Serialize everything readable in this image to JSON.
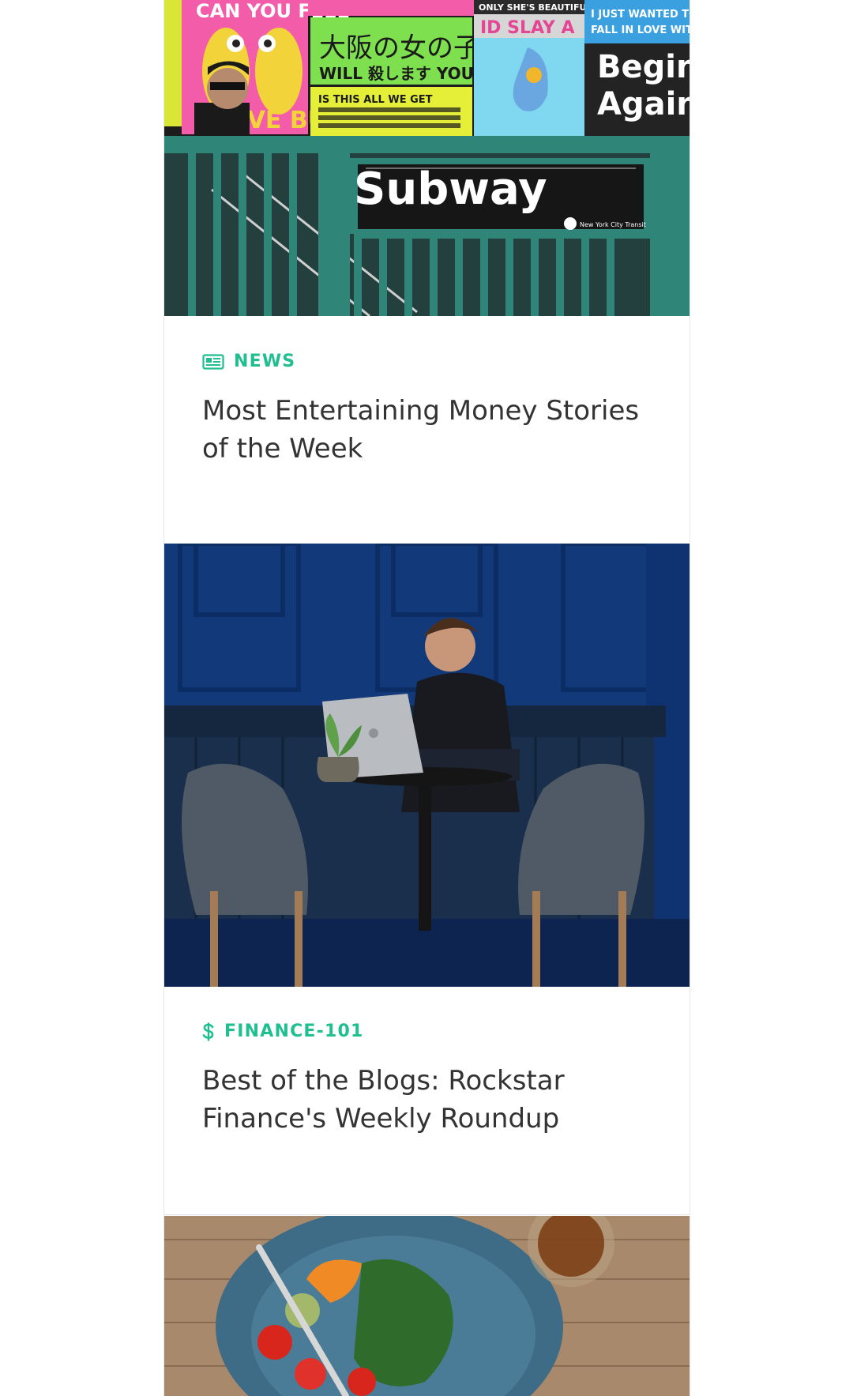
{
  "posts": [
    {
      "category": "NEWS",
      "category_icon": "newspaper-icon",
      "title": "Most Entertaining Money Stories of the Week",
      "image": {
        "subject": "subway-entrance-photo",
        "sign_text": "Subway",
        "sign_subtext": "New York City Transit",
        "poster_texts": [
          "CAN YOU FEEL",
          "ONLY SHE'S BEAUTIFUL",
          "I JUST WANTED TO FALL IN LOVE WITH YOU",
          "ID SLAY A",
          "Begin Again",
          "大阪の女の子",
          "WILL 殺します YOU",
          "IS THIS ALL WE GET",
          "OVE BUZZ"
        ]
      }
    },
    {
      "category": "FINANCE-101",
      "category_icon": "dollar-icon",
      "title": "Best of the Blogs: Rockstar Finance's Weekly Roundup",
      "image": {
        "subject": "man-with-laptop-in-cafe-photo"
      }
    },
    {
      "image": {
        "subject": "salad-bowl-photo"
      }
    }
  ],
  "colors": {
    "accent": "#1fbf8f",
    "title_text": "#333333",
    "card_border": "#e6e6e6"
  }
}
